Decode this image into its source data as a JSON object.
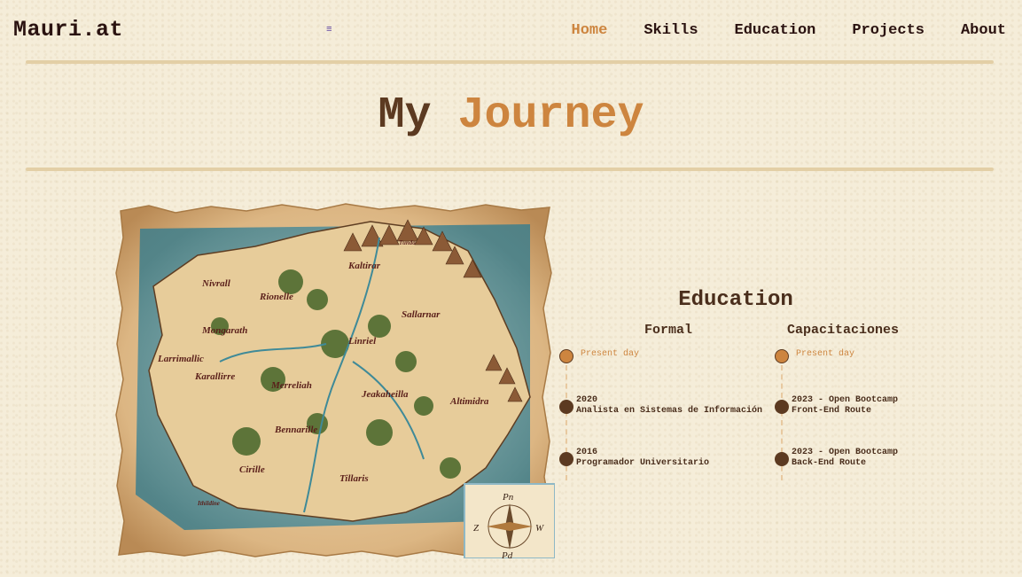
{
  "nav": {
    "brand": "Mauri.at",
    "menu_icon": "≡",
    "links": [
      "Home",
      "Skills",
      "Education",
      "Projects",
      "About"
    ],
    "active": "Home"
  },
  "hero": {
    "title_part1": "My",
    "title_part2": "Journey"
  },
  "education": {
    "title": "Education",
    "formal": {
      "heading": "Formal",
      "items": [
        {
          "line1": "Present day",
          "line2": ""
        },
        {
          "line1": "2020",
          "line2": "Analista en Sistemas de Información"
        },
        {
          "line1": "2016",
          "line2": "Programador Universitario"
        }
      ]
    },
    "capacitaciones": {
      "heading": "Capacitaciones",
      "items": [
        {
          "line1": "Present day",
          "line2": ""
        },
        {
          "line1": "2023 - Open Bootcamp",
          "line2": "Front-End Route"
        },
        {
          "line1": "2023 - Open Bootcamp",
          "line2": "Back-End Route"
        }
      ]
    }
  },
  "map": {
    "labels": [
      "Nivrall",
      "Kaltirar",
      "Tunda",
      "Rionelle",
      "Sallarnar",
      "Larrimallic",
      "Mongarath",
      "Linriel",
      "Karallirre",
      "Merreliah",
      "Jeakaheilla",
      "Altimidra",
      "Bennarille",
      "Cirille",
      "Tillaris",
      "Ithildine"
    ],
    "compass": [
      "Pn",
      "W",
      "Z",
      "Pd"
    ]
  },
  "colors": {
    "accent": "#cd853f",
    "text": "#3a2418",
    "background": "#f5edd9",
    "rule": "#e3cfa6"
  }
}
